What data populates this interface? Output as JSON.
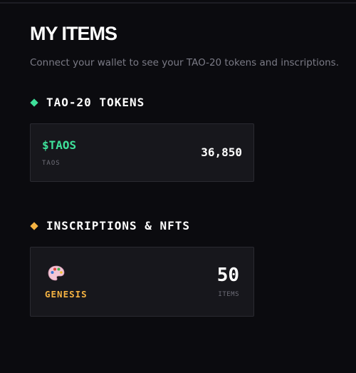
{
  "header": {
    "title": "MY ITEMS",
    "subtitle": "Connect your wallet to see your TAO-20 tokens and inscriptions."
  },
  "tokens_section": {
    "title": "TAO-20 TOKENS",
    "marker_color": "#3ee09a",
    "items": [
      {
        "ticker": "$TAOS",
        "sub": "TAOS",
        "amount": "36,850",
        "color": "#3ee09a"
      }
    ]
  },
  "nfts_section": {
    "title": "INSCRIPTIONS & NFTS",
    "marker_color": "#f5b342",
    "items": [
      {
        "icon": "palette-icon",
        "name": "GENESIS",
        "count": "50",
        "unit": "ITEMS",
        "color": "#f5b342"
      }
    ]
  }
}
